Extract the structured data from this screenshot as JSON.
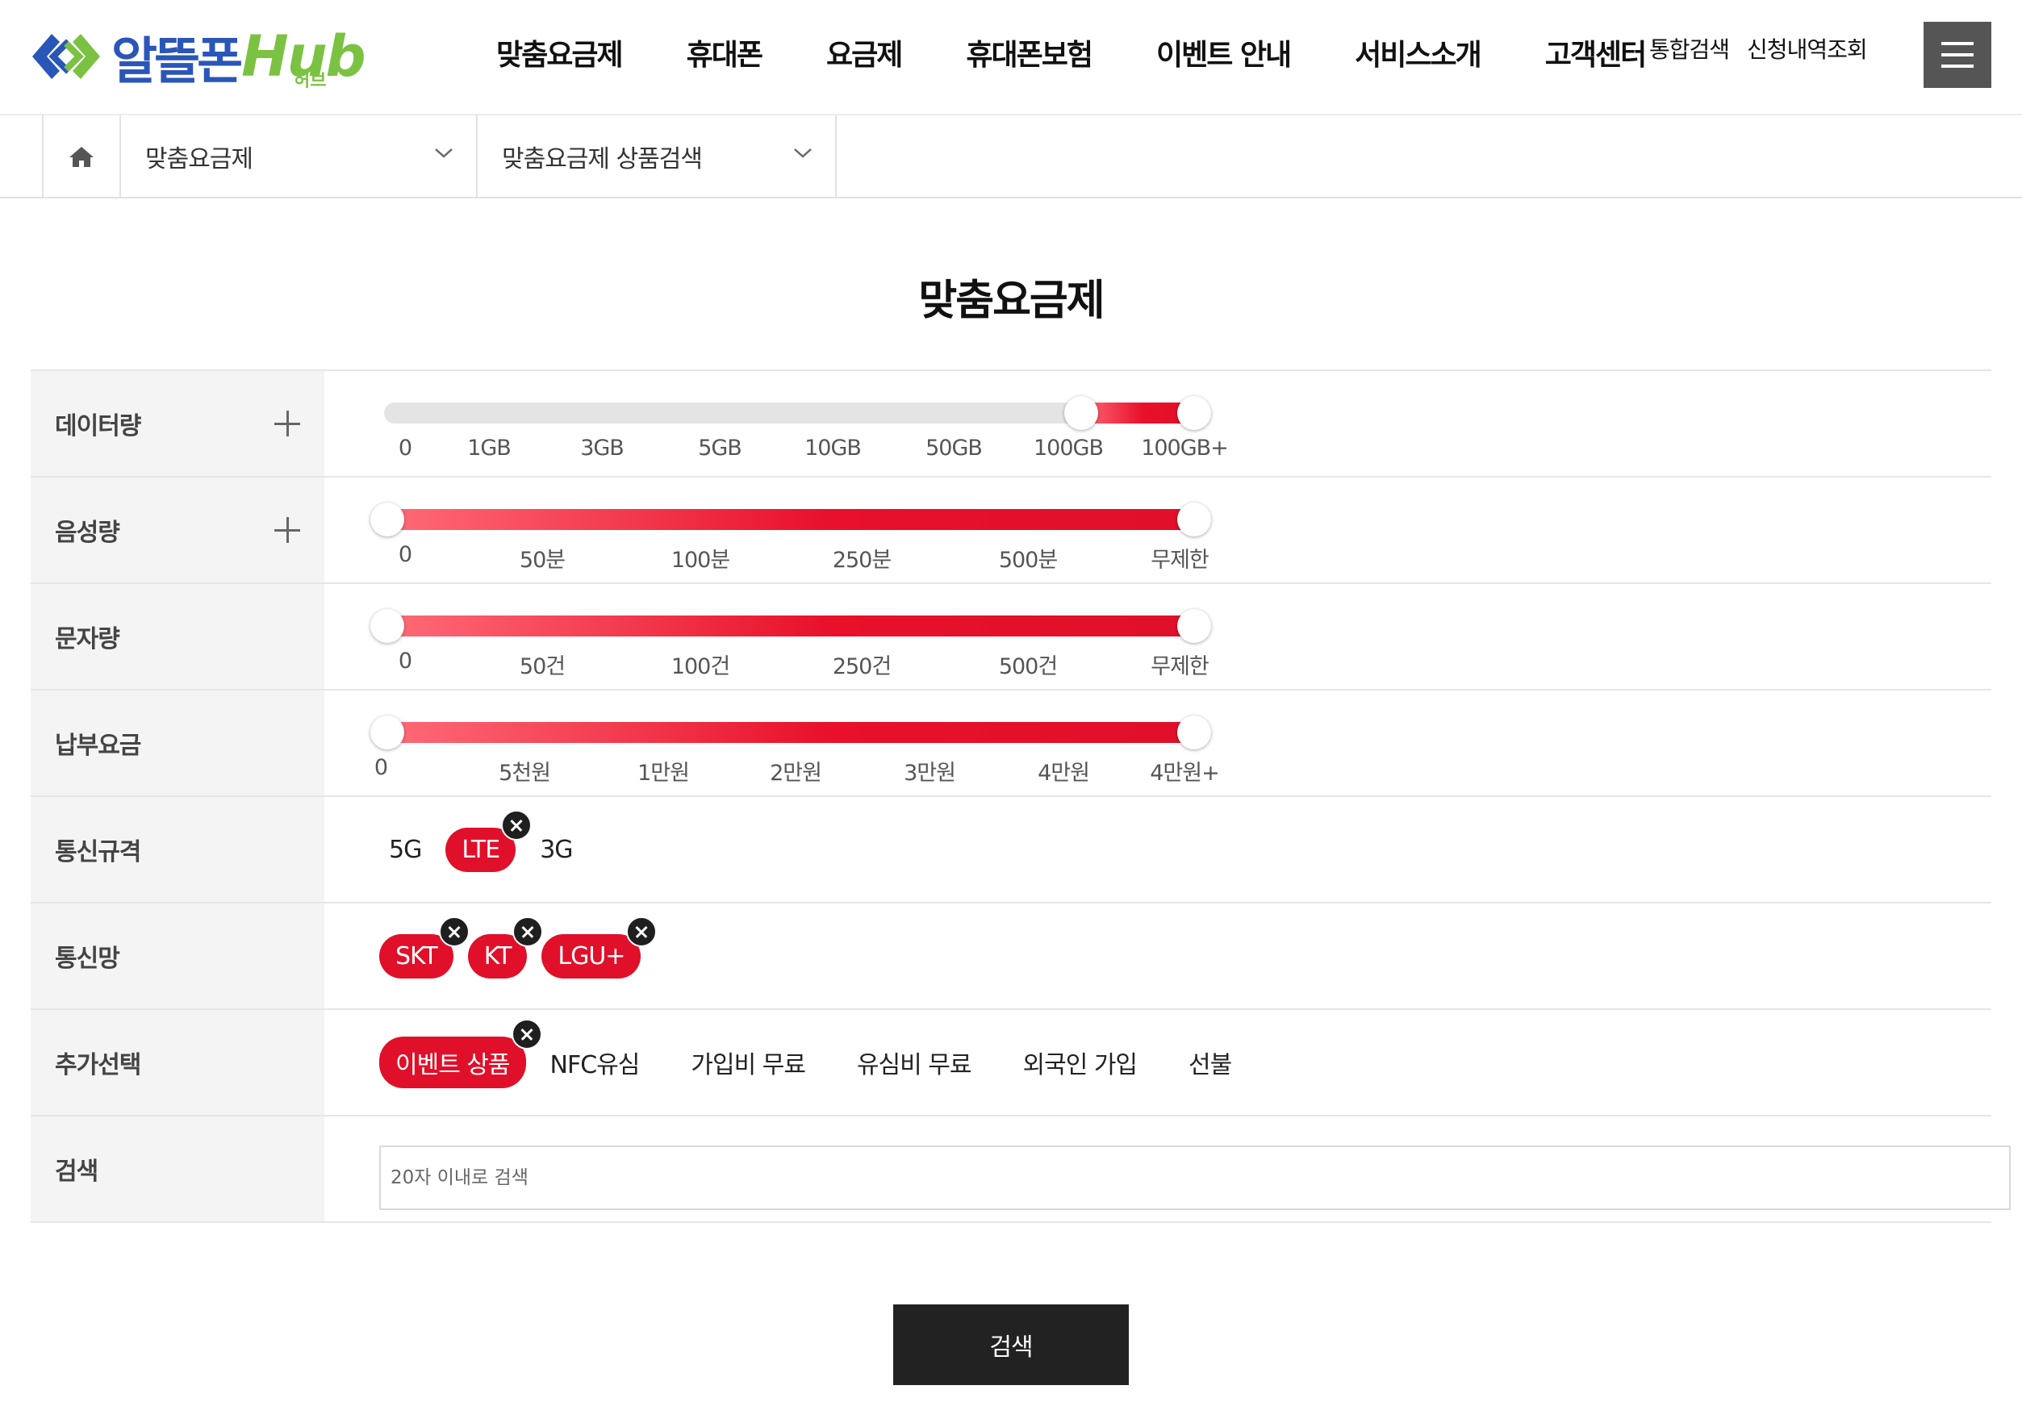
{
  "logo": {
    "main": "알뜰폰",
    "hub": "Hub",
    "sub": "허브"
  },
  "gnb": [
    {
      "label": "맞춤요금제",
      "name": "gnb-custom-plan"
    },
    {
      "label": "휴대폰",
      "name": "gnb-phones"
    },
    {
      "label": "요금제",
      "name": "gnb-plans"
    },
    {
      "label": "휴대폰보험",
      "name": "gnb-phone-insurance"
    },
    {
      "label": "이벤트 안내",
      "name": "gnb-events"
    },
    {
      "label": "서비스소개",
      "name": "gnb-service-intro"
    },
    {
      "label": "고객센터",
      "name": "gnb-customer-center"
    }
  ],
  "util": [
    {
      "label": "통합검색",
      "name": "util-integrated-search"
    },
    {
      "label": "신청내역조회",
      "name": "util-application-history"
    }
  ],
  "breadcrumb": {
    "home_icon": "home-icon",
    "level1": "맞춤요금제",
    "level2": "맞춤요금제 상품검색"
  },
  "page_title": "맞춤요금제",
  "filters": {
    "data": {
      "label": "데이터량",
      "ticks": [
        "0",
        "1GB",
        "3GB",
        "5GB",
        "10GB",
        "50GB",
        "100GB",
        "100GB+"
      ],
      "selected_min": "100GB",
      "selected_max": "100GB+"
    },
    "voice": {
      "label": "음성량",
      "ticks": [
        "0",
        "50분",
        "100분",
        "250분",
        "500분",
        "무제한"
      ],
      "selected_min": "0",
      "selected_max": "무제한"
    },
    "sms": {
      "label": "문자량",
      "ticks": [
        "0",
        "50건",
        "100건",
        "250건",
        "500건",
        "무제한"
      ],
      "selected_min": "0",
      "selected_max": "무제한"
    },
    "fee": {
      "label": "납부요금",
      "ticks": [
        "0",
        "5천원",
        "1만원",
        "2만원",
        "3만원",
        "4만원",
        "4만원+"
      ],
      "selected_min": "0",
      "selected_max": "4만원+"
    },
    "network_type": {
      "label": "통신규격",
      "options": [
        {
          "label": "5G",
          "selected": false
        },
        {
          "label": "LTE",
          "selected": true
        },
        {
          "label": "3G",
          "selected": false
        }
      ]
    },
    "carrier": {
      "label": "통신망",
      "options": [
        {
          "label": "SKT",
          "selected": true
        },
        {
          "label": "KT",
          "selected": true
        },
        {
          "label": "LGU+",
          "selected": true
        }
      ]
    },
    "extra": {
      "label": "추가선택",
      "options": [
        {
          "label": "이벤트 상품",
          "selected": true
        },
        {
          "label": "NFC유심",
          "selected": false
        },
        {
          "label": "가입비 무료",
          "selected": false
        },
        {
          "label": "유심비 무료",
          "selected": false
        },
        {
          "label": "외국인 가입",
          "selected": false
        },
        {
          "label": "선불",
          "selected": false
        }
      ]
    },
    "search": {
      "label": "검색",
      "placeholder": "20자 이내로 검색",
      "value": ""
    }
  },
  "search_button": "검색",
  "colors": {
    "accent": "#e0102a",
    "dark": "#222222",
    "logo_blue": "#2a56b8",
    "logo_green": "#7cc242"
  }
}
